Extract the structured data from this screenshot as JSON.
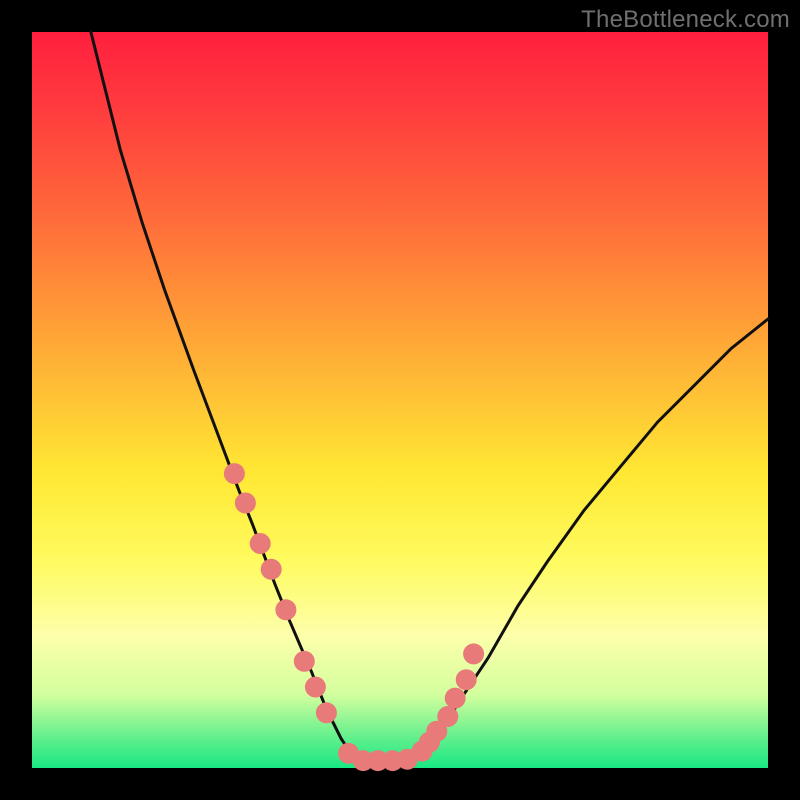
{
  "watermark": "TheBottleneck.com",
  "chart_data": {
    "type": "line",
    "title": "",
    "xlabel": "",
    "ylabel": "",
    "ylim": [
      0,
      100
    ],
    "xlim": [
      0,
      100
    ],
    "grid": false,
    "legend": false,
    "background_gradient": {
      "top": "#ff1f3f",
      "mid": "#ffe833",
      "bottom": "#18e884"
    },
    "series": [
      {
        "name": "bottleneck-curve",
        "color": "#111111",
        "x": [
          8,
          10,
          12,
          15,
          18,
          22,
          25,
          28,
          30,
          33,
          35,
          38,
          40,
          42,
          44,
          46,
          48,
          50,
          52,
          55,
          58,
          62,
          66,
          70,
          75,
          80,
          85,
          90,
          95,
          100
        ],
        "y_pct": [
          100,
          92,
          84,
          74,
          65,
          54,
          46,
          38,
          33,
          25,
          20,
          13,
          8,
          4,
          1,
          0,
          0,
          0,
          1,
          4,
          9,
          15,
          22,
          28,
          35,
          41,
          47,
          52,
          57,
          61
        ]
      }
    ],
    "markers": {
      "name": "highlighted-points",
      "color": "#e97a7a",
      "radius": 10.5,
      "x": [
        27.5,
        29,
        31,
        32.5,
        34.5,
        37,
        38.5,
        40,
        43,
        45,
        47,
        49,
        51,
        53,
        54,
        55,
        56.5,
        57.5,
        59,
        60
      ],
      "y_pct": [
        40,
        36,
        30.5,
        27,
        21.5,
        14.5,
        11,
        7.5,
        2,
        1,
        1,
        1,
        1.2,
        2.3,
        3.5,
        5,
        7,
        9.5,
        12,
        15.5
      ]
    }
  }
}
